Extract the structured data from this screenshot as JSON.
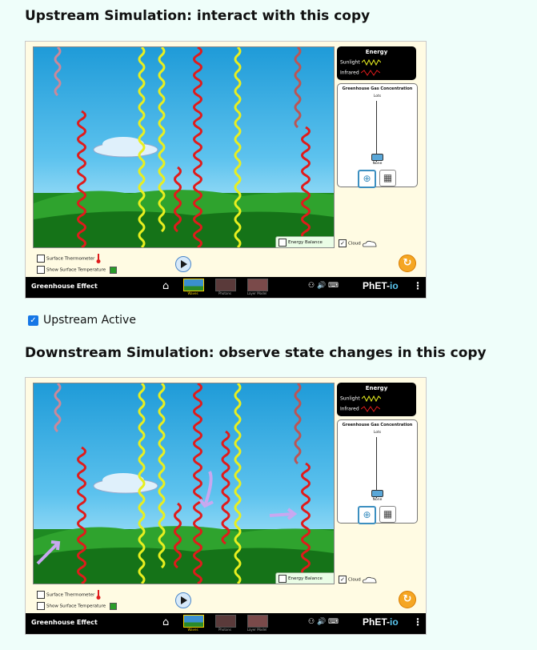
{
  "page": {
    "upstream_heading": "Upstream Simulation: interact with this copy",
    "downstream_heading": "Downstream Simulation: observe state changes in this copy",
    "upstream_active": {
      "label": "Upstream Active",
      "checked": true
    }
  },
  "sim": {
    "energy_title": "Energy",
    "sunlight_label": "Sunlight",
    "infrared_label": "Infrared",
    "gas_title": "Greenhouse Gas Concentration",
    "lots_label": "Lots",
    "none_label": "None",
    "energy_balance_label": "Energy Balance",
    "cloud_label": "Cloud",
    "surface_thermometer_label": "Surface Thermometer",
    "surface_temp_label": "Show Surface Temperature",
    "nav_title": "Greenhouse Effect",
    "screens": [
      "Waves",
      "Photons",
      "Layer Model"
    ],
    "phet_brand": "PhET",
    "phet_io": "io",
    "colors": {
      "sunlight": "#e8ef1f",
      "infrared": "#e01b1b",
      "accent": "#f5a623"
    }
  }
}
